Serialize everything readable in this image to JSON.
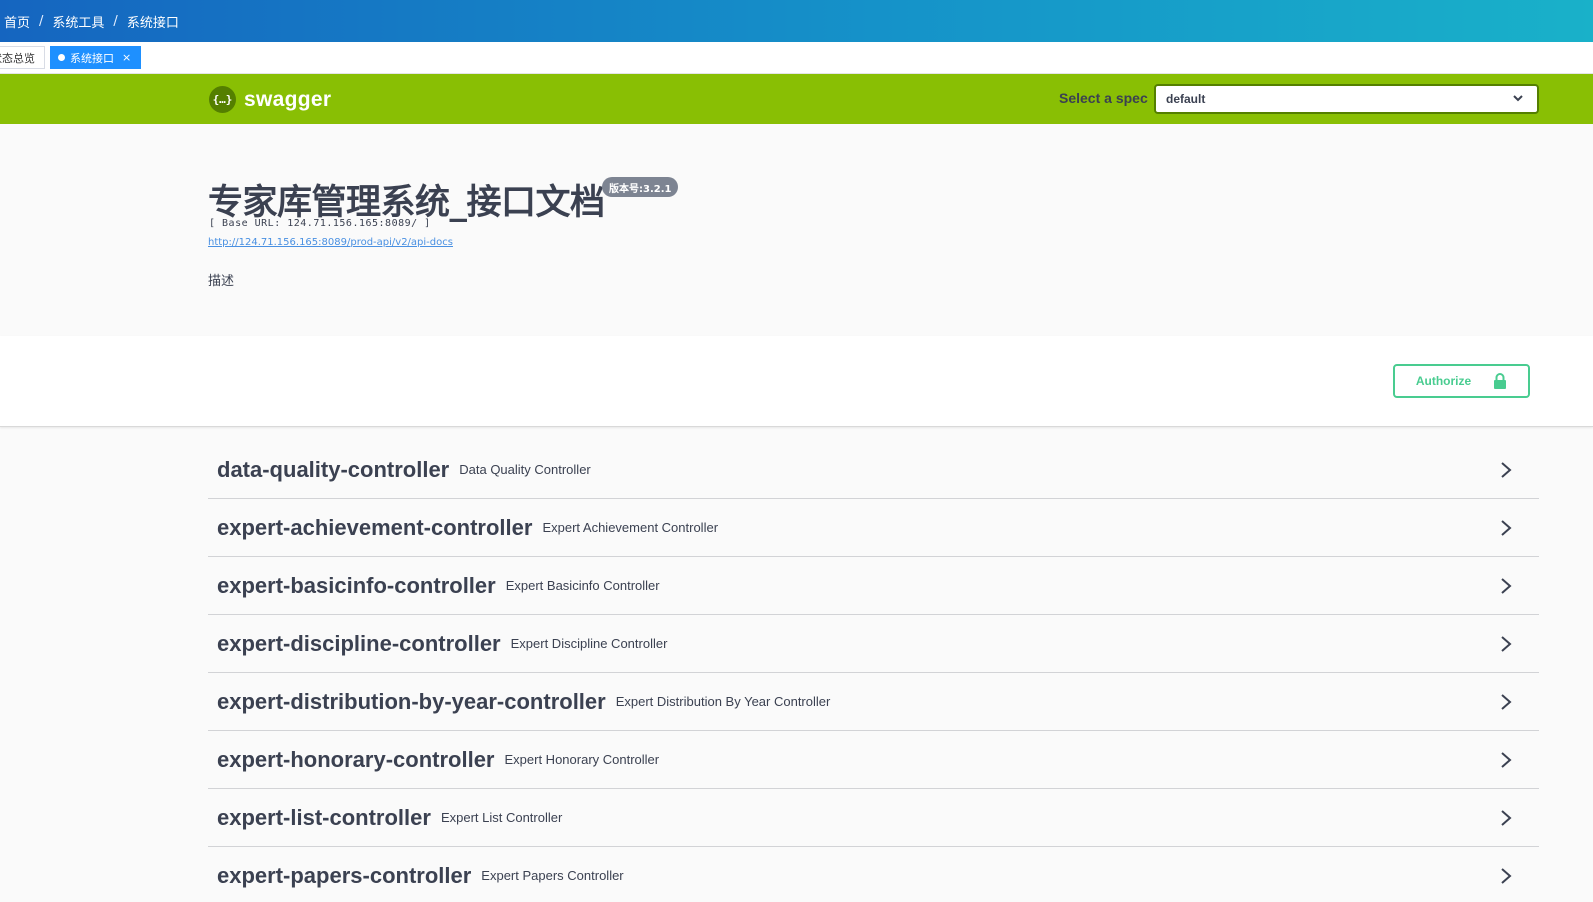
{
  "breadcrumb": [
    "首页",
    "系统工具",
    "系统接口"
  ],
  "tags": [
    {
      "label": "状态总览",
      "active": false
    },
    {
      "label": "系统接口",
      "active": true,
      "close": "×"
    }
  ],
  "swagger": {
    "logo_glyph": "{…}",
    "logo_text": "swagger",
    "spec_label": "Select a spec",
    "spec_value": "default"
  },
  "info": {
    "title": "专家库管理系统_接口文档",
    "version": "版本号:3.2.1",
    "base_url": "[ Base URL: 124.71.156.165:8089/ ]",
    "api_docs_link": "http://124.71.156.165:8089/prod-api/v2/api-docs",
    "description": "描述"
  },
  "authorize_label": "Authorize",
  "controllers": [
    {
      "name": "data-quality-controller",
      "desc": "Data Quality Controller"
    },
    {
      "name": "expert-achievement-controller",
      "desc": "Expert Achievement Controller"
    },
    {
      "name": "expert-basicinfo-controller",
      "desc": "Expert Basicinfo Controller"
    },
    {
      "name": "expert-discipline-controller",
      "desc": "Expert Discipline Controller"
    },
    {
      "name": "expert-distribution-by-year-controller",
      "desc": "Expert Distribution By Year Controller"
    },
    {
      "name": "expert-honorary-controller",
      "desc": "Expert Honorary Controller"
    },
    {
      "name": "expert-list-controller",
      "desc": "Expert List Controller"
    },
    {
      "name": "expert-papers-controller",
      "desc": "Expert Papers Controller"
    }
  ],
  "colors": {
    "swagger_green": "#89bf04",
    "authorize_green": "#49cc90",
    "tab_blue": "#1e90ff"
  }
}
